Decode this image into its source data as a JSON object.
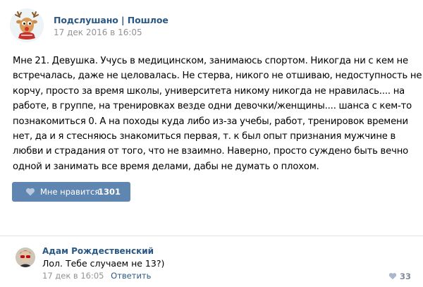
{
  "post": {
    "author": "Подслушано | Пошлое",
    "date": "17 дек 2016 в 16:05",
    "avatar_icon": "deer-cartoon-avatar",
    "text_lines": [
      "Мне 21. Девушка. Учусь в медицинском, занимаюсь спортом. Никогда ни с кем не",
      "встречалась, даже не целовалась. Не стерва, никого не отшиваю, недоступность не",
      "корчу, просто за время школы, университета никому никогда не нравилась.... на",
      "работе, в группе, на тренировках везде одни девочки/женщины.... шанса с кем-то",
      "познакомиться 0. А на походы куда либо из-за учебы, работ, тренировок времени",
      "нет, да и я стесняюсь знакомиться первая, т. к был опыт признания мужчине в",
      "любви и страдания от того, что не взаимно. Наверно, просто суждено быть вечно",
      "одной и занимать все время делами, дабы не думать о плохом."
    ],
    "like": {
      "label": "Мне нравится",
      "count": "1301",
      "icon": "heart-icon",
      "color": "#5f85b1"
    }
  },
  "comment": {
    "author": "Адам Рождественский",
    "text": "Лол. Тебе случаем не 13?)",
    "date": "17 дек в 16:05",
    "reply_label": "Ответить",
    "like_count": "33",
    "avatar_icon": "user-photo-avatar"
  },
  "colors": {
    "link": "#2a5885",
    "meta_gray": "#939393",
    "like_button": "#5f85b1",
    "divider": "#e1e3e6"
  }
}
